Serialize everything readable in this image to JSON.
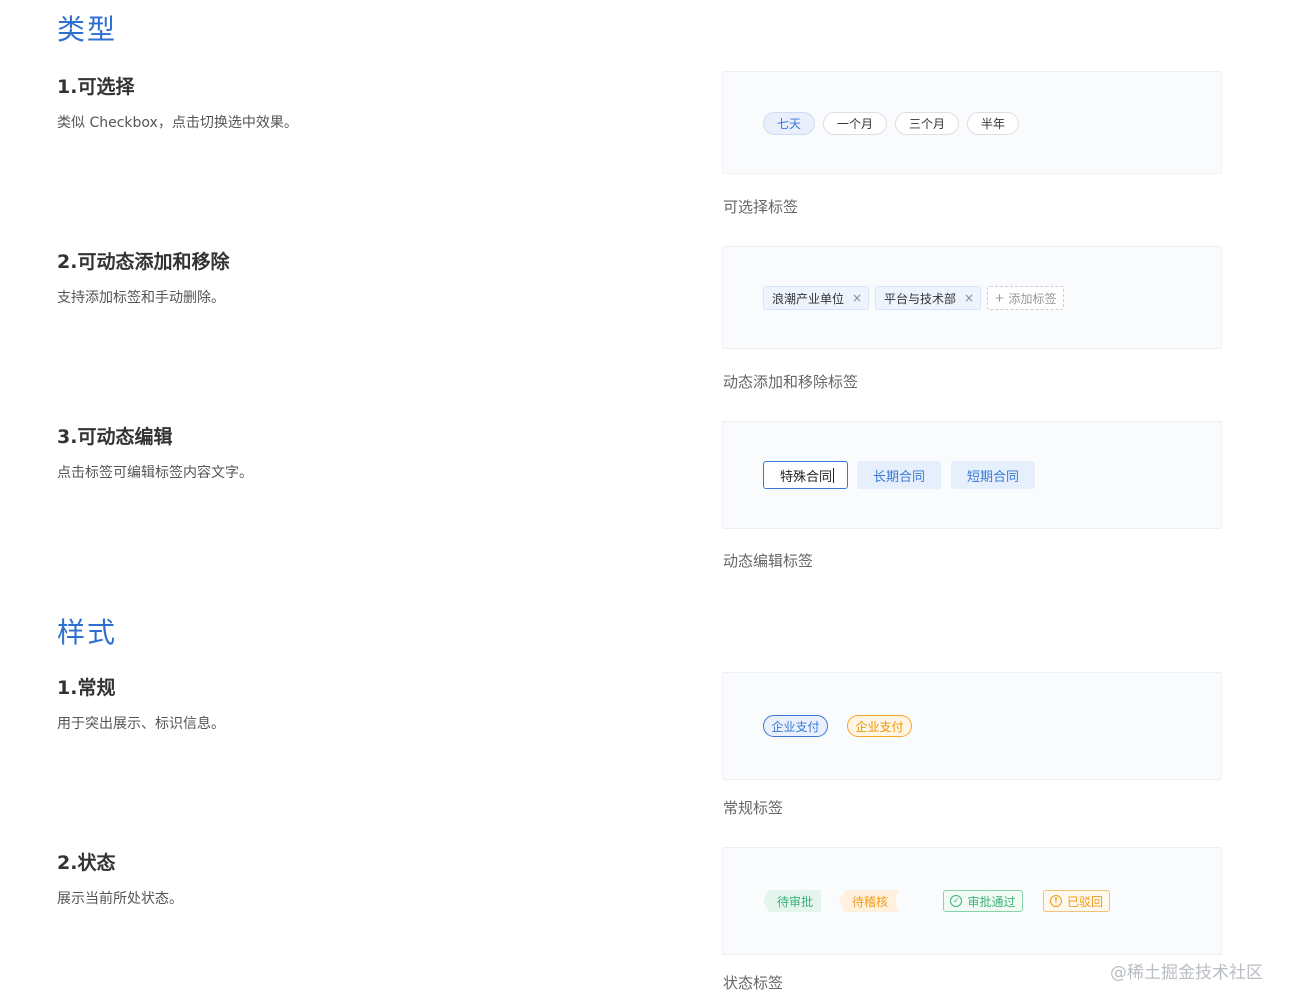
{
  "sections": {
    "types_title": "类型",
    "styles_title": "样式"
  },
  "selectable": {
    "title": "1.可选择",
    "desc": "类似 Checkbox，点击切换选中效果。",
    "tags": [
      "七天",
      "一个月",
      "三个月",
      "半年"
    ],
    "active_index": 0,
    "caption": "可选择标签"
  },
  "dynamic": {
    "title": "2.可动态添加和移除",
    "desc": "支持添加标签和手动删除。",
    "tags": [
      "浪潮产业单位",
      "平台与技术部"
    ],
    "close_symbol": "×",
    "add_label": "添加标签",
    "add_symbol": "+",
    "caption": "动态添加和移除标签"
  },
  "editable": {
    "title": "3.可动态编辑",
    "desc": "点击标签可编辑标签内容文字。",
    "editing_value": "特殊合同",
    "tags": [
      "长期合同",
      "短期合同"
    ],
    "caption": "动态编辑标签"
  },
  "regular": {
    "title": "1.常规",
    "desc": "用于突出展示、标识信息。",
    "tags": [
      "企业支付",
      "企业支付"
    ],
    "colors": {
      "blue": "#3b78d8",
      "orange": "#f5a623"
    },
    "caption": "常规标签"
  },
  "status": {
    "title": "2.状态",
    "desc": "展示当前所处状态。",
    "tags": [
      "待审批",
      "待稽核",
      "审批通过",
      "已驳回"
    ],
    "icons": {
      "pass": "check-circle-icon",
      "reject": "exclamation-circle-icon"
    },
    "caption": "状态标签"
  },
  "watermark": "@稀土掘金技术社区"
}
